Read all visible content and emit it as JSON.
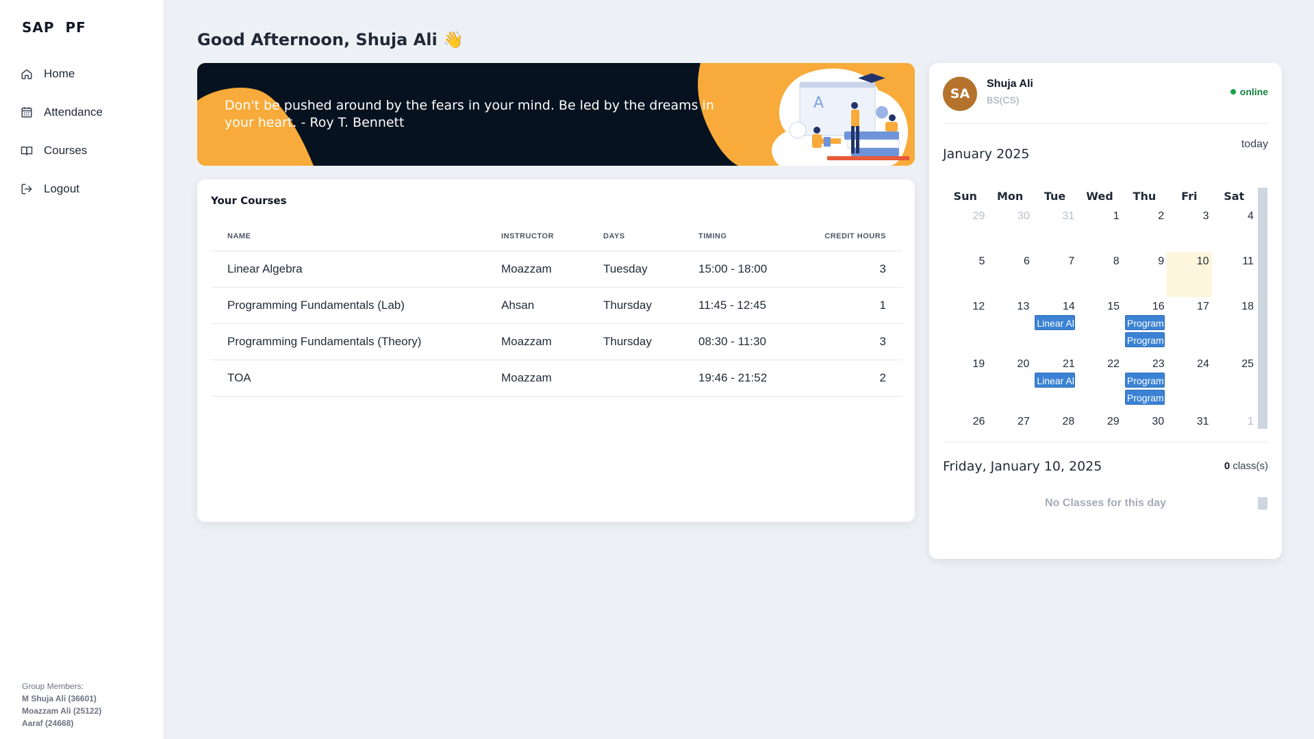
{
  "app": {
    "brand": "SAP  PF"
  },
  "sidebar": {
    "items": [
      {
        "label": "Home",
        "icon": "home-icon"
      },
      {
        "label": "Attendance",
        "icon": "calendar-grid-icon"
      },
      {
        "label": "Courses",
        "icon": "book-icon"
      },
      {
        "label": "Logout",
        "icon": "logout-icon"
      }
    ],
    "members_title": "Group Members:",
    "members": [
      "M Shuja Ali (36601)",
      "Moazzam Ali (25122)",
      "Aaraf (24668)"
    ]
  },
  "greeting": "Good Afternoon, Shuja Ali 👋",
  "banner": {
    "quote": "Don't be pushed around by the fears in your mind. Be led by the dreams in your heart. - Roy T. Bennett"
  },
  "courses": {
    "title": "Your Courses",
    "columns": [
      "NAME",
      "INSTRUCTOR",
      "DAYS",
      "TIMING",
      "CREDIT HOURS"
    ],
    "rows": [
      [
        "Linear Algebra",
        "Moazzam",
        "Tuesday",
        "15:00 - 18:00",
        "3"
      ],
      [
        "Programming Fundamentals (Lab)",
        "Ahsan",
        "Thursday",
        "11:45 - 12:45",
        "1"
      ],
      [
        "Programming Fundamentals (Theory)",
        "Moazzam",
        "Thursday",
        "08:30 - 11:30",
        "3"
      ],
      [
        "TOA",
        "Moazzam",
        "",
        "19:46 - 21:52",
        "2"
      ]
    ]
  },
  "profile": {
    "initials": "SA",
    "name": "Shuja Ali",
    "program": "BS(CS)",
    "status": "online"
  },
  "calendar": {
    "month_label": "January 2025",
    "today_label": "today",
    "weekdays": [
      "Sun",
      "Mon",
      "Tue",
      "Wed",
      "Thu",
      "Fri",
      "Sat"
    ],
    "weeks": [
      [
        {
          "d": "29",
          "m": true
        },
        {
          "d": "30",
          "m": true
        },
        {
          "d": "31",
          "m": true
        },
        {
          "d": "1"
        },
        {
          "d": "2"
        },
        {
          "d": "3"
        },
        {
          "d": "4"
        }
      ],
      [
        {
          "d": "5"
        },
        {
          "d": "6"
        },
        {
          "d": "7"
        },
        {
          "d": "8"
        },
        {
          "d": "9"
        },
        {
          "d": "10",
          "t": true
        },
        {
          "d": "11"
        }
      ],
      [
        {
          "d": "12"
        },
        {
          "d": "13"
        },
        {
          "d": "14",
          "e": [
            "Linear Al"
          ]
        },
        {
          "d": "15"
        },
        {
          "d": "16",
          "e": [
            "Program",
            "Program"
          ]
        },
        {
          "d": "17"
        },
        {
          "d": "18"
        }
      ],
      [
        {
          "d": "19"
        },
        {
          "d": "20"
        },
        {
          "d": "21",
          "e": [
            "Linear Al"
          ]
        },
        {
          "d": "22"
        },
        {
          "d": "23",
          "e": [
            "Program",
            "Program"
          ]
        },
        {
          "d": "24"
        },
        {
          "d": "25"
        }
      ],
      [
        {
          "d": "26"
        },
        {
          "d": "27"
        },
        {
          "d": "28"
        },
        {
          "d": "29"
        },
        {
          "d": "30"
        },
        {
          "d": "31"
        },
        {
          "d": "1",
          "m": true
        }
      ]
    ],
    "selected_date": "Friday, January 10, 2025",
    "class_count": "0",
    "class_suffix": " class(s)",
    "no_classes": "No Classes for this day"
  },
  "colors": {
    "accent": "#3b82d4",
    "banner_orange": "#f8ab3a",
    "banner_dark": "#06121f",
    "avatar": "#b5722d",
    "online": "#15803d"
  }
}
